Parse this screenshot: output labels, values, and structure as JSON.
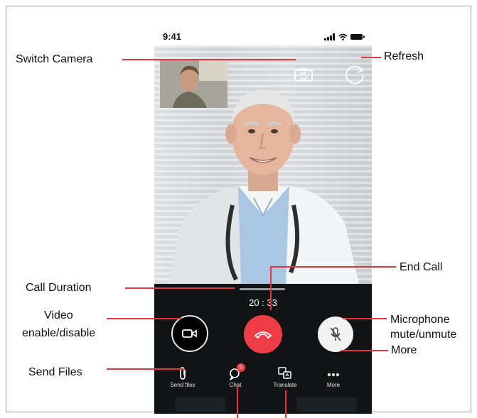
{
  "status_bar": {
    "time": "9:41"
  },
  "call": {
    "duration": "20 : 33"
  },
  "toolbar": {
    "send_files": "Send files",
    "chat": "Chat",
    "chat_badge": "5",
    "translate": "Translate",
    "more": "More"
  },
  "annotations": {
    "switch_camera": "Switch Camera",
    "refresh": "Refresh",
    "call_duration": "Call Duration",
    "end_call": "End Call",
    "video_line1": "Video",
    "video_line2": "enable/disable",
    "mic_line1": "Microphone",
    "mic_line2": "mute/unmute",
    "send_files": "Send Files",
    "more": "More"
  },
  "colors": {
    "end_call": "#ef3d48",
    "annotation_line": "#e8323e",
    "control_bar": "#121314"
  },
  "icons": [
    "signal-icon",
    "wifi-icon",
    "battery-icon",
    "switch-camera-icon",
    "refresh-icon",
    "video-camera-icon",
    "end-call-icon",
    "microphone-muted-icon",
    "paperclip-icon",
    "chat-icon",
    "translate-icon",
    "more-dots-icon"
  ]
}
